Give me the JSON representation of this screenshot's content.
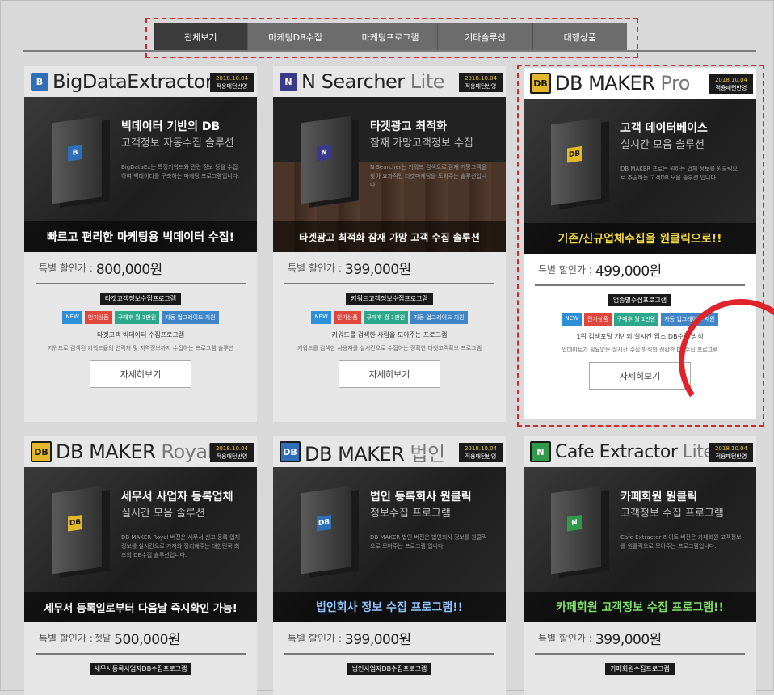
{
  "nav": [
    "전체보기",
    "마케팅DB수집",
    "마케팅프로그램",
    "기타솔루션",
    "대행상품"
  ],
  "colors": {
    "accent_red": "#d8262c",
    "tag_new": "#2c8fd8",
    "tag_hot": "#e0453b",
    "tag_buy": "#2aa889",
    "tag_auto": "#3f85c8"
  },
  "badge": {
    "date": "2018.10.04",
    "sub": "적용패턴반영"
  },
  "common": {
    "price_label": "특별 할인가 :",
    "detail_button": "자세히보기",
    "tags": [
      "NEW",
      "인기상품",
      "구매후 월 1만원",
      "자동 업그레이드 지원"
    ]
  },
  "cards": [
    {
      "logo": "B",
      "brand_a": "BigData",
      "brand_b": "Extractor",
      "title": "빅데이터 기반의 DB",
      "sub": "고객정보 자동수집 솔루션",
      "desc": "BigDataEx는 특정키워드와 관련 정보 등을 수집하여 빅데이터를 구축하는 마케팅 프로그램입니다.",
      "strip": "빠르고 편리한 마케팅용 빅데이터 수집!",
      "price": "800,000원",
      "prefix": "",
      "plabel": "타겟고객정보수집프로그램",
      "ptxt": "타겟고객 빅데이터 수집프로그램",
      "psm": "키워드로 검색된 키워드들의 연락처 및 지역정보까지 수집하는 프로그램 솔루션"
    },
    {
      "logo": "N",
      "brand_a": "N Searcher",
      "brand_b": " Lite",
      "title": "타겟광고 최적화",
      "sub": "잠재 가망고객정보 수집",
      "desc": "N Searcher는 키워드 검색으로 잠재 가망고객을 찾아 효과적인 타겟마케팅을 도와주는 솔루션입니다.",
      "strip": "타겟광고 최적화 잠재 가망 고객 수집 솔루션",
      "price": "399,000원",
      "prefix": "",
      "plabel": "키워드고객정보수집프로그램",
      "ptxt": "키워드를 검색한 사람을 모아주는 프로그램",
      "psm": "키워드를 검색한 사용자를 실시간으로 수집하는 정확한 타겟고객확보 프로그램"
    },
    {
      "logo": "DB",
      "brand_a": "DB MAKER",
      "brand_b": " Pro",
      "title": "고객 데이터베이스",
      "sub": "실시간 모음 솔루션",
      "desc": "DB MAKER 프로는 원하는 업체 정보를 원클릭으로 추출하는 고객DB 모음 솔루션 입니다.",
      "strip": "기존/신규업체수집을 원클릭으로!!",
      "price": "499,000원",
      "prefix": "",
      "plabel": "업종별수집프로그램",
      "ptxt": "1위 검색포털 기반의 실시간 업소 DB수집 방식",
      "psm": "업데이트가 필요없는 실시간 수집 방식의 정확한 DB수집 프로그램"
    },
    {
      "logo": "DB",
      "brand_a": "DB MAKER",
      "brand_b": " Royal",
      "title": "세무서 사업자 등록업체",
      "sub": "실시간 모음 솔루션",
      "desc": "DB MAKER Royal 버전은 세무서 신고 등록 업체 정보를 실시간으로 가져와 정리해주는 대한민국 최초의 DB수집 솔루션입니다.",
      "strip": "세무서 등록일로부터 다음날 즉시확인 가능!",
      "price": "500,000원",
      "prefix": "첫달",
      "plabel": "세무서등록사업자DB수집프로그램",
      "ptxt": "",
      "psm": ""
    },
    {
      "logo": "DB",
      "brand_a": "DB MAKER",
      "brand_b": " 법인",
      "title": "법인 등록회사 원클릭",
      "sub": "정보수집 프로그램",
      "desc": "DB MAKER 법인 버전은 법인회사 정보를 원클릭으로 모아주는 프로그램 입니다.",
      "strip": "법인회사 정보 수집 프로그램!!",
      "price": "399,000원",
      "prefix": "",
      "plabel": "법인사업자DB수집프로그램",
      "ptxt": "",
      "psm": ""
    },
    {
      "logo": "N",
      "brand_a": "Cafe Extractor",
      "brand_b": " Lite",
      "title": "카페회원 원클릭",
      "sub": "고객정보 수집 프로그램",
      "desc": "Cafe Extractor 라이트 버전은 카페회원 고객정보를 원클릭으로 모아주는 프로그램입니다.",
      "strip": "카페회원 고객정보 수집 프로그램!!",
      "price": "399,000원",
      "prefix": "",
      "plabel": "카페회원수집프로그램",
      "ptxt": "",
      "psm": ""
    }
  ]
}
